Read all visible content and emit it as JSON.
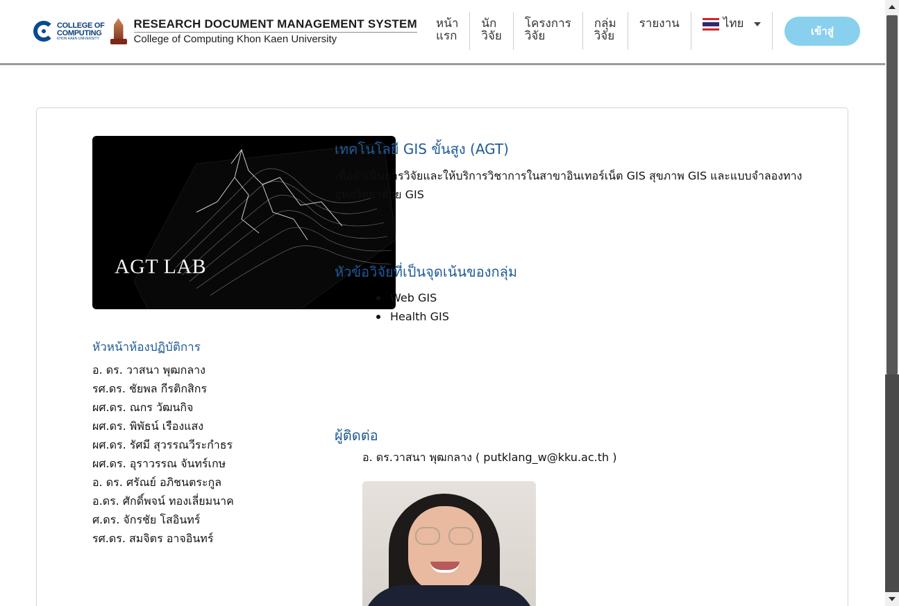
{
  "header": {
    "college_logo": {
      "line1": "COLLEGE OF",
      "line2": "COMPUTING",
      "line3": "KHON KAEN UNIVERSITY"
    },
    "title": "RESEARCH DOCUMENT MANAGEMENT SYSTEM",
    "subtitle": "College of Computing Khon Kaen University",
    "nav": [
      {
        "line1": "หน้า",
        "line2": "แรก"
      },
      {
        "line1": "นัก",
        "line2": "วิจัย"
      },
      {
        "line1": "โครงการ",
        "line2": "วิจัย"
      },
      {
        "line1": "กลุ่ม",
        "line2": "วิจัย"
      },
      {
        "line1": "รายงาน",
        "line2": ""
      }
    ],
    "language": {
      "label": "ไทย",
      "flag_colors": [
        "#d2232a",
        "#ffffff",
        "#2d2a6e",
        "#ffffff",
        "#d2232a"
      ]
    },
    "login_label": "เข้าสู่"
  },
  "lab": {
    "image_caption": "AGT LAB",
    "name": "เทคโนโลยี GIS ขั้นสูง (AGT)",
    "description": "เพื่อดำเนินการวิจัยและให้บริการวิชาการในสาขาอินเทอร์เน็ต GIS สุขภาพ GIS และแบบจำลองทางอุทกวิทยาด้วย GIS",
    "focus_heading": "หัวข้อวิจัยที่เป็นจุดเน้นของกลุ่ม",
    "focus_topics": [
      "Web GIS",
      "Health GIS"
    ],
    "head_heading": "หัวหน้าห้องปฏิบัติการ",
    "members": [
      "อ. ดร. วาสนา พุฒกลาง",
      "รศ.ดร. ชัยพล กีรติกสิกร",
      "ผศ.ดร. ณกร วัฒนกิจ",
      "ผศ.ดร. พิพัธน์ เรืองแสง",
      "ผศ.ดร. รัศมี สุวรรณวีระกำธร",
      "ผศ.ดร. อุราวรรณ จันทร์เกษ",
      "อ. ดร. ศรัณย์ อภิชนตระกูล",
      "อ.ดร. ศักดิ์พจน์ ทองเลี่ยมนาค",
      "ศ.ดร. จักรชัย โสอินทร์",
      "รศ.ดร. สมจิตร อาจอินทร์"
    ],
    "contact_heading": "ผู้ติดต่อ",
    "contact": "อ. ดร.วาสนา พุฒกลาง ( putklang_w@kku.ac.th )"
  },
  "colors": {
    "heading": "#1f5a96",
    "login_button": "#89d0ee",
    "header_border": "#9a9a9a"
  }
}
